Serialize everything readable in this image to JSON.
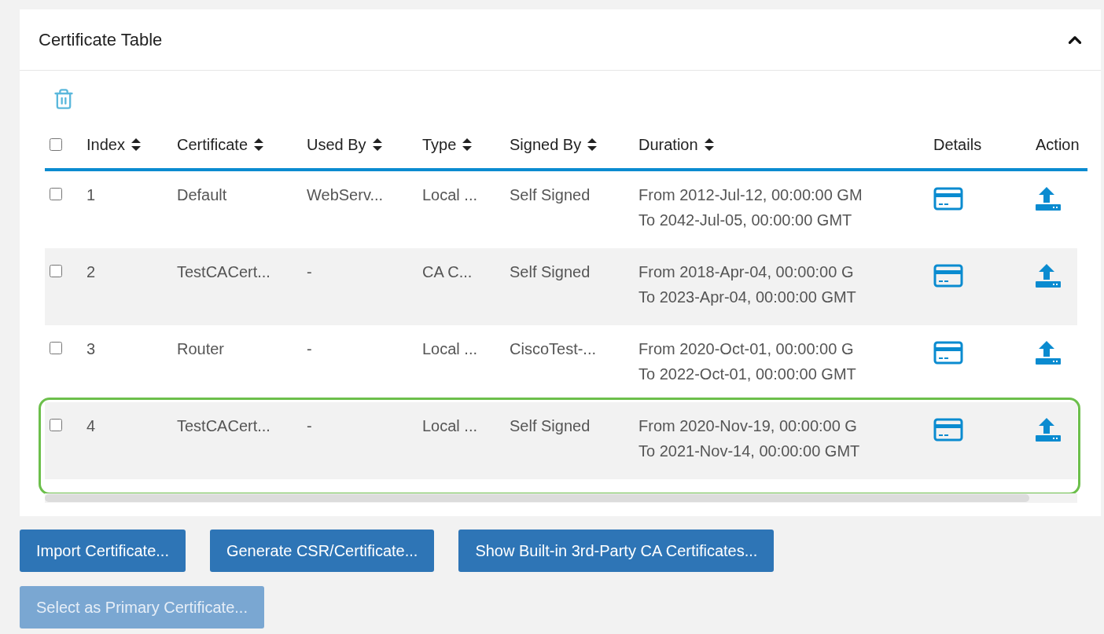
{
  "card": {
    "title": "Certificate Table",
    "expanded": true
  },
  "table": {
    "select_all": {
      "checked": false
    },
    "columns": [
      {
        "label": "Index",
        "sortable": true
      },
      {
        "label": "Certificate",
        "sortable": true
      },
      {
        "label": "Used By",
        "sortable": true
      },
      {
        "label": "Type",
        "sortable": true
      },
      {
        "label": "Signed By",
        "sortable": true
      },
      {
        "label": "Duration",
        "sortable": true
      },
      {
        "label": "Details",
        "sortable": false
      },
      {
        "label": "Action",
        "sortable": false
      }
    ],
    "rows": [
      {
        "checked": false,
        "highlighted": false,
        "index": "1",
        "certificate": "Default",
        "used_by": "WebServ...",
        "type": "Local ...",
        "signed_by": "Self Signed",
        "duration": [
          "From 2012-Jul-12, 00:00:00 GM",
          "To 2042-Jul-05, 00:00:00 GMT"
        ]
      },
      {
        "checked": false,
        "highlighted": false,
        "index": "2",
        "certificate": "TestCACert...",
        "used_by": "-",
        "type": "CA C...",
        "signed_by": "Self Signed",
        "duration": [
          "From 2018-Apr-04, 00:00:00 G",
          "To 2023-Apr-04, 00:00:00 GMT"
        ]
      },
      {
        "checked": false,
        "highlighted": false,
        "index": "3",
        "certificate": "Router",
        "used_by": "-",
        "type": "Local ...",
        "signed_by": "CiscoTest-...",
        "duration": [
          "From 2020-Oct-01, 00:00:00 G",
          "To 2022-Oct-01, 00:00:00 GMT"
        ]
      },
      {
        "checked": false,
        "highlighted": true,
        "index": "4",
        "certificate": "TestCACert...",
        "used_by": "-",
        "type": "Local ...",
        "signed_by": "Self Signed",
        "duration": [
          "From 2020-Nov-19, 00:00:00 G",
          "To 2021-Nov-14, 00:00:00 GMT"
        ]
      }
    ]
  },
  "buttons": [
    {
      "label": "Import Certificate...",
      "disabled": false
    },
    {
      "label": "Generate CSR/Certificate...",
      "disabled": false
    },
    {
      "label": "Show Built-in 3rd-Party CA Certificates...",
      "disabled": false
    },
    {
      "label": "Select as Primary Certificate...",
      "disabled": true
    }
  ]
}
